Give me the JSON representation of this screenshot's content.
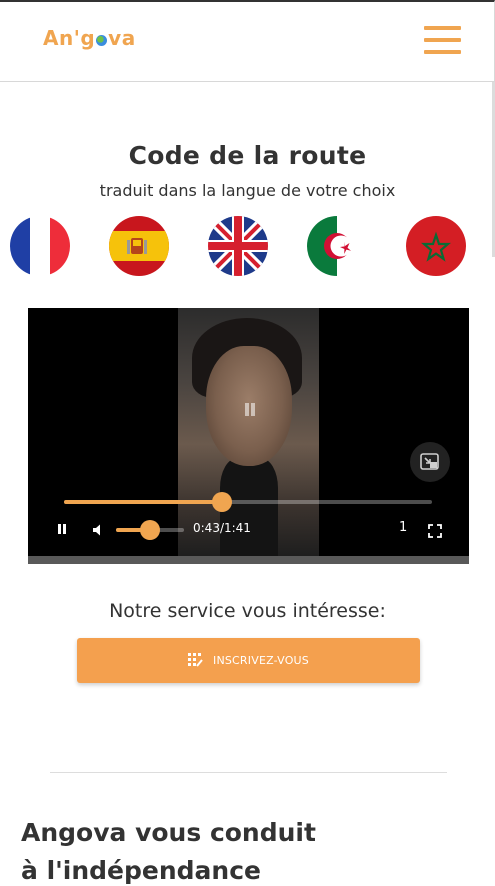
{
  "header": {
    "logo_text_before": "An'g",
    "logo_text_after": "va",
    "menu_icon": "hamburger-menu-icon"
  },
  "hero": {
    "title": "Code de la route",
    "subtitle": "traduit dans la langue de votre choix"
  },
  "flags": [
    {
      "icon": "france-flag-icon"
    },
    {
      "icon": "spain-flag-icon"
    },
    {
      "icon": "united-kingdom-flag-icon"
    },
    {
      "icon": "algeria-flag-icon"
    },
    {
      "icon": "morocco-flag-icon"
    }
  ],
  "video": {
    "current_time": "0:43",
    "duration": "1:41",
    "time_display": "0:43/1:41",
    "progress": 0.43,
    "volume": 0.5,
    "playback_speed": "1",
    "accent_color": "#f0a550"
  },
  "signup": {
    "prompt": "Notre service vous intéresse:",
    "button_label": "INSCRIVEZ-VOUS",
    "button_icon": "dialpad-icon",
    "button_color": "#f4a04e"
  },
  "section": {
    "title_line1": "Angova vous conduit",
    "title_line2": "à l'indépendance"
  }
}
